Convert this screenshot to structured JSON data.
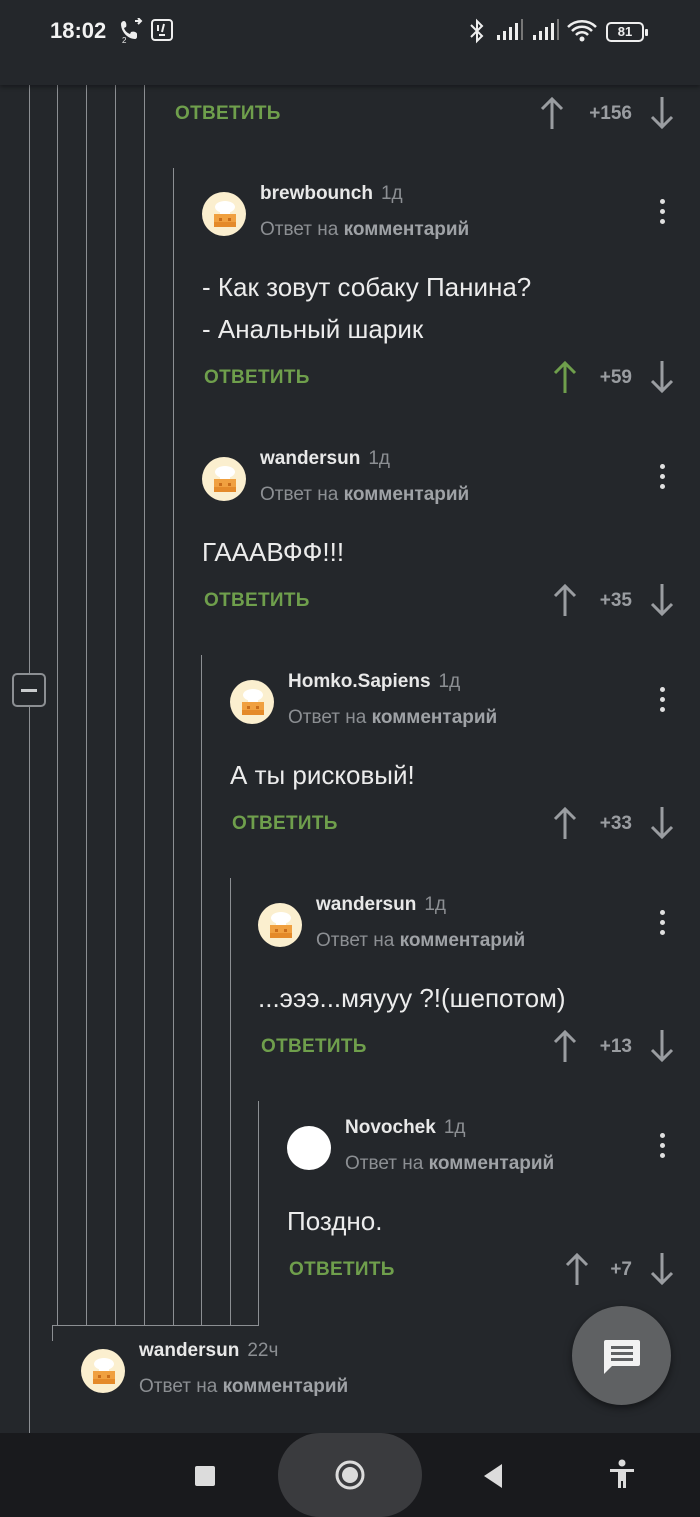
{
  "status_bar": {
    "time": "18:02",
    "battery": "81"
  },
  "top_partial": {
    "reply_label": "ОТВЕТИТЬ",
    "score": "+156"
  },
  "comments": [
    {
      "author": "brewbounch",
      "time": "1д",
      "reply_prefix": "Ответ на",
      "reply_link": "комментарий",
      "body": [
        "- Как зовут собаку Панина?",
        "- Анальный шарик"
      ],
      "reply_label": "ОТВЕТИТЬ",
      "score": "+59",
      "upvoted": true
    },
    {
      "author": "wandersun",
      "time": "1д",
      "reply_prefix": "Ответ на",
      "reply_link": "комментарий",
      "body": [
        "ГАААВФФ!!!"
      ],
      "reply_label": "ОТВЕТИТЬ",
      "score": "+35",
      "upvoted": false
    },
    {
      "author": "Homko.Sapiens",
      "time": "1д",
      "reply_prefix": "Ответ на",
      "reply_link": "комментарий",
      "body": [
        "А ты рисковый!"
      ],
      "reply_label": "ОТВЕТИТЬ",
      "score": "+33",
      "upvoted": false
    },
    {
      "author": "wandersun",
      "time": "1д",
      "reply_prefix": "Ответ на",
      "reply_link": "комментарий",
      "body": [
        "...эээ...мяууу ?!(шепотом)"
      ],
      "reply_label": "ОТВЕТИТЬ",
      "score": "+13",
      "upvoted": false
    },
    {
      "author": "Novochek",
      "time": "1д",
      "reply_prefix": "Ответ на",
      "reply_link": "комментарий",
      "body": [
        "Поздно."
      ],
      "reply_label": "ОТВЕТИТЬ",
      "score": "+7",
      "upvoted": false
    },
    {
      "author": "wandersun",
      "time": "22ч",
      "reply_prefix": "Ответ на",
      "reply_link": "комментарий",
      "body": [],
      "reply_label": "",
      "score": "",
      "upvoted": false
    }
  ],
  "colors": {
    "background": "#24272b",
    "reply_green": "#6f9f4c",
    "upvote_active": "#6f9f4c",
    "muted": "#8c8f93"
  },
  "icons": {
    "fab": "comment-icon",
    "nav": [
      "recents-icon",
      "home-icon",
      "back-icon",
      "accessibility-icon"
    ]
  }
}
